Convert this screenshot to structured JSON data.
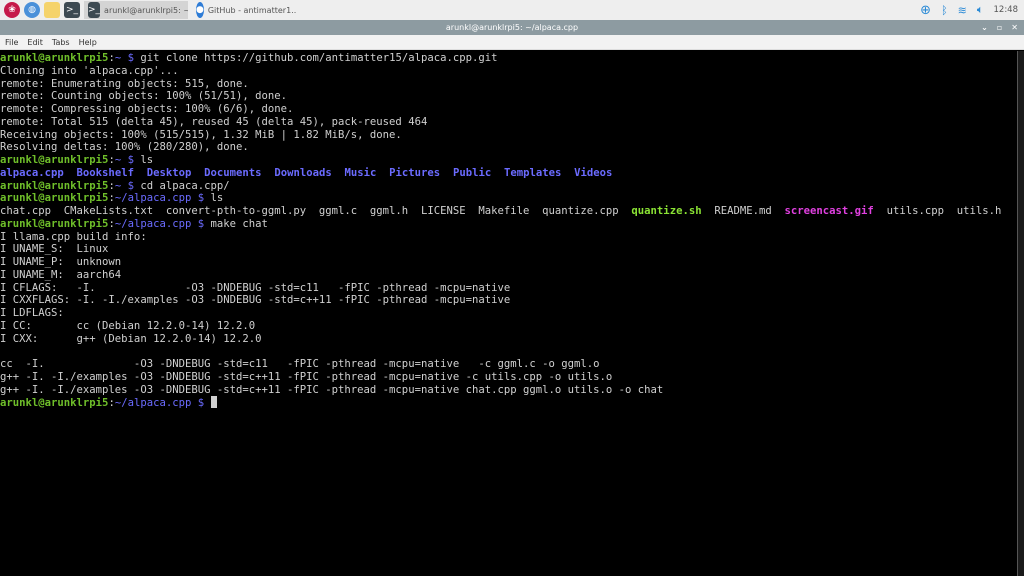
{
  "taskbar": {
    "tasks": [
      {
        "label": "arunkl@arunklrpi5: ~...",
        "icon": "terminal-icon"
      },
      {
        "label": "GitHub - antimatter1...",
        "icon": "chromium-icon"
      }
    ],
    "clock": "12:48"
  },
  "window": {
    "title": "arunkl@arunklrpi5: ~/alpaca.cpp"
  },
  "menu": [
    "File",
    "Edit",
    "Tabs",
    "Help"
  ],
  "colors": {
    "prompt": "#6fbf2a",
    "path": "#6b6bff",
    "dir": "#6b6bff",
    "exec": "#8ae234",
    "image": "#e040e0",
    "bg": "#000000"
  },
  "terminal": {
    "lines": [
      [
        [
          "ug",
          "arunkl@arunklrpi5"
        ],
        [
          "",
          "："
        ],
        [
          "b",
          "~ $"
        ],
        [
          "",
          "git clone https://github.com/antimatter15/alpaca.cpp.git"
        ]
      ],
      [
        [
          "",
          "Cloning into 'alpaca.cpp'..."
        ]
      ],
      [
        [
          "",
          "remote: Enumerating objects: 515, done."
        ]
      ],
      [
        [
          "",
          "remote: Counting objects: 100% (51/51), done."
        ]
      ],
      [
        [
          "",
          "remote: Compressing objects: 100% (6/6), done."
        ]
      ],
      [
        [
          "",
          "remote: Total 515 (delta 45), reused 45 (delta 45), pack-reused 464"
        ]
      ],
      [
        [
          "",
          "Receiving objects: 100% (515/515), 1.32 MiB | 1.82 MiB/s, done."
        ]
      ],
      [
        [
          "",
          "Resolving deltas: 100% (280/280), done."
        ]
      ],
      [
        [
          "ug",
          "arunkl@arunklrpi5"
        ],
        [
          "",
          ":"
        ],
        [
          "b",
          "~ $"
        ],
        [
          "",
          "ls"
        ]
      ],
      [
        [
          "bd",
          "alpaca.cpp"
        ],
        [
          "",
          "  "
        ],
        [
          "bd",
          "Bookshelf"
        ],
        [
          "",
          "  "
        ],
        [
          "bd",
          "Desktop"
        ],
        [
          "",
          "  "
        ],
        [
          "bd",
          "Documents"
        ],
        [
          "",
          "  "
        ],
        [
          "bd",
          "Downloads"
        ],
        [
          "",
          "  "
        ],
        [
          "bd",
          "Music"
        ],
        [
          "",
          "  "
        ],
        [
          "bd",
          "Pictures"
        ],
        [
          "",
          "  "
        ],
        [
          "bd",
          "Public"
        ],
        [
          "",
          "  "
        ],
        [
          "bd",
          "Templates"
        ],
        [
          "",
          "  "
        ],
        [
          "bd",
          "Videos"
        ]
      ],
      [
        [
          "ug",
          "arunkl@arunklrpi5"
        ],
        [
          "",
          ":"
        ],
        [
          "b",
          "~ $"
        ],
        [
          "",
          "cd alpaca.cpp/"
        ]
      ],
      [
        [
          "ug",
          "arunkl@arunklrpi5"
        ],
        [
          "",
          ":"
        ],
        [
          "b",
          "~/alpaca.cpp $"
        ],
        [
          "",
          "ls"
        ]
      ],
      [
        [
          "",
          "chat.cpp  CMakeLists.txt  convert-pth-to-ggml.py  ggml.c  ggml.h  LICENSE  Makefile  quantize.cpp  "
        ],
        [
          "g",
          "quantize.sh"
        ],
        [
          "",
          "  README.md  "
        ],
        [
          "m",
          "screencast.gif"
        ],
        [
          "",
          "  utils.cpp  utils.h"
        ]
      ],
      [
        [
          "ug",
          "arunkl@arunklrpi5"
        ],
        [
          "",
          ":"
        ],
        [
          "b",
          "~/alpaca.cpp $"
        ],
        [
          "",
          "make chat"
        ]
      ],
      [
        [
          "",
          "I llama.cpp build info:"
        ]
      ],
      [
        [
          "",
          "I UNAME_S:  Linux"
        ]
      ],
      [
        [
          "",
          "I UNAME_P:  unknown"
        ]
      ],
      [
        [
          "",
          "I UNAME_M:  aarch64"
        ]
      ],
      [
        [
          "",
          "I CFLAGS:   -I.              -O3 -DNDEBUG -std=c11   -fPIC -pthread -mcpu=native"
        ]
      ],
      [
        [
          "",
          "I CXXFLAGS: -I. -I./examples -O3 -DNDEBUG -std=c++11 -fPIC -pthread -mcpu=native"
        ]
      ],
      [
        [
          "",
          "I LDFLAGS:"
        ]
      ],
      [
        [
          "",
          "I CC:       cc (Debian 12.2.0-14) 12.2.0"
        ]
      ],
      [
        [
          "",
          "I CXX:      g++ (Debian 12.2.0-14) 12.2.0"
        ]
      ],
      [
        [
          "",
          ""
        ]
      ],
      [
        [
          "",
          "cc  -I.              -O3 -DNDEBUG -std=c11   -fPIC -pthread -mcpu=native   -c ggml.c -o ggml.o"
        ]
      ],
      [
        [
          "",
          "g++ -I. -I./examples -O3 -DNDEBUG -std=c++11 -fPIC -pthread -mcpu=native -c utils.cpp -o utils.o"
        ]
      ],
      [
        [
          "",
          "g++ -I. -I./examples -O3 -DNDEBUG -std=c++11 -fPIC -pthread -mcpu=native chat.cpp ggml.o utils.o -o chat"
        ]
      ],
      [
        [
          "ug",
          "arunkl@arunklrpi5"
        ],
        [
          "",
          ":"
        ],
        [
          "b",
          "~/alpaca.cpp $"
        ],
        [
          "cursor",
          ""
        ]
      ]
    ]
  }
}
